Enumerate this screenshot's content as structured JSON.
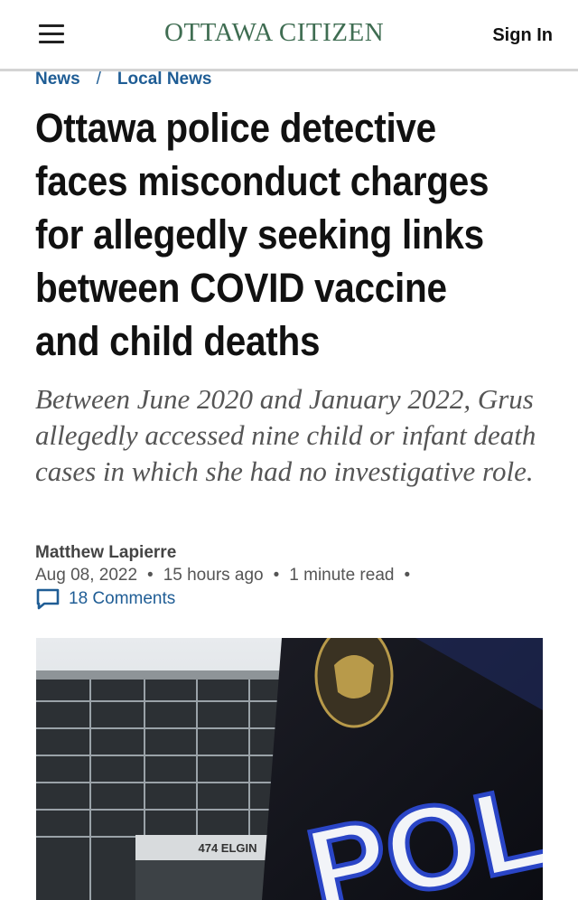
{
  "header": {
    "logo_text": "OTTAWA CITIZEN",
    "sign_in_label": "Sign In",
    "menu_icon": "hamburger-menu-icon",
    "brand_color": "#3f6d52"
  },
  "breadcrumb": {
    "items": [
      "News",
      "Local News"
    ],
    "separator": "/",
    "link_color": "#1f5d95"
  },
  "article": {
    "headline": "Ottawa police detective faces misconduct charges for allegedly seeking links between COVID vaccine and child deaths",
    "dek": "Between June 2020 and January 2022, Grus allegedly accessed nine child or infant death cases in which she had no investigative role.",
    "author": "Matthew Lapierre",
    "date": "Aug 08, 2022",
    "time_ago": "15 hours ago",
    "read_time": "1 minute read",
    "meta_separator": "•",
    "comments_label": "18 Comments",
    "comments_icon": "comment-bubble-icon"
  },
  "photo": {
    "building_sign": "474 ELGIN",
    "vehicle_text": "POLICE"
  }
}
